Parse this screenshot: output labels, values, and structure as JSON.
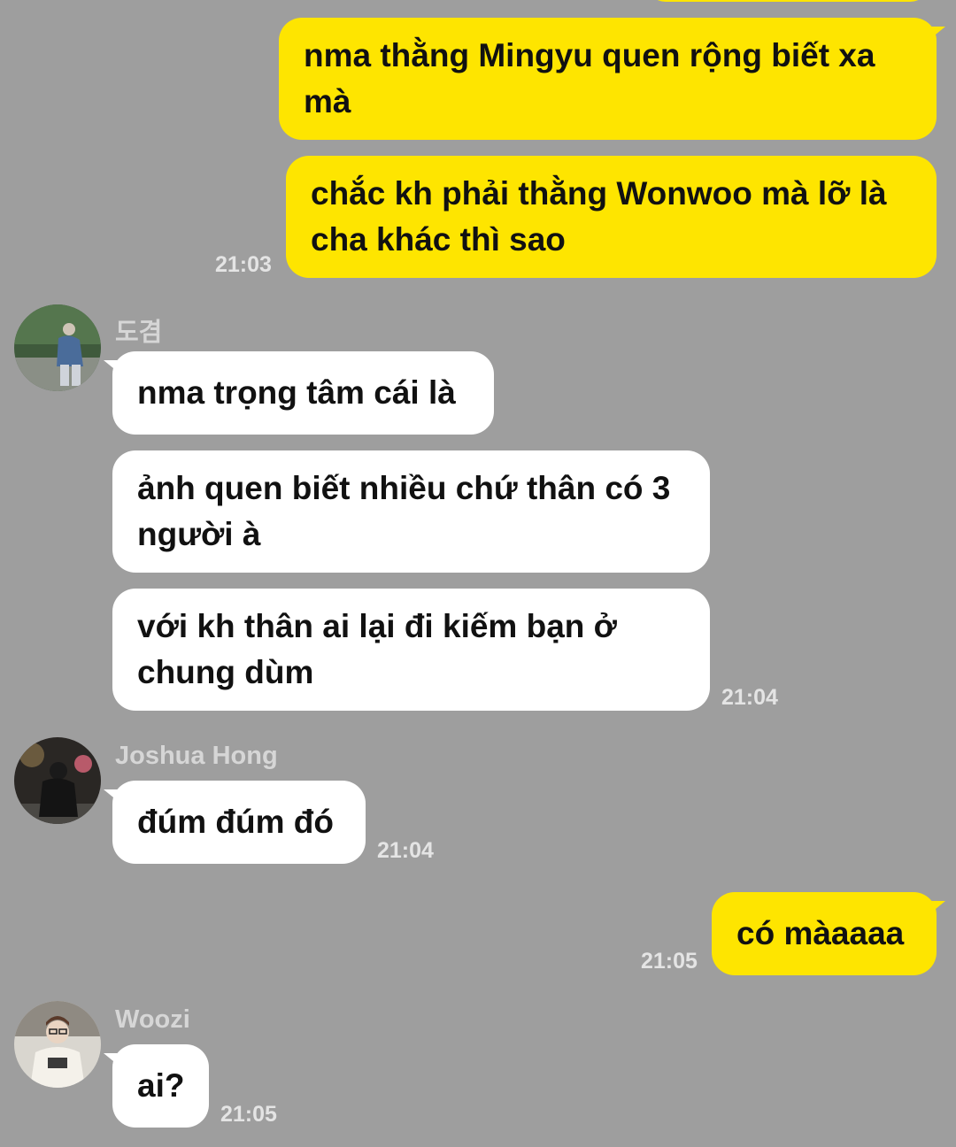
{
  "colors": {
    "background": "#9e9e9e",
    "mine": "#fee500",
    "theirs": "#ffffff"
  },
  "messages": {
    "m1": "nma thằng Mingyu quen rộng biết xa mà",
    "m2": "chắc kh phải thằng Wonwoo mà lỡ là cha khác thì sao",
    "t1": "21:03",
    "g1": {
      "sender": "도겸",
      "a": "nma trọng tâm cái là",
      "b": "ảnh quen biết nhiều chứ thân có 3 người à",
      "c": "với kh thân ai lại đi kiếm bạn ở chung dùm",
      "time": "21:04"
    },
    "g2": {
      "sender": "Joshua Hong",
      "a": "đúm đúm đó",
      "time": "21:04"
    },
    "m3": "có màaaaa",
    "t3": "21:05",
    "g3": {
      "sender": "Woozi",
      "a": "ai?",
      "time": "21:05"
    }
  }
}
